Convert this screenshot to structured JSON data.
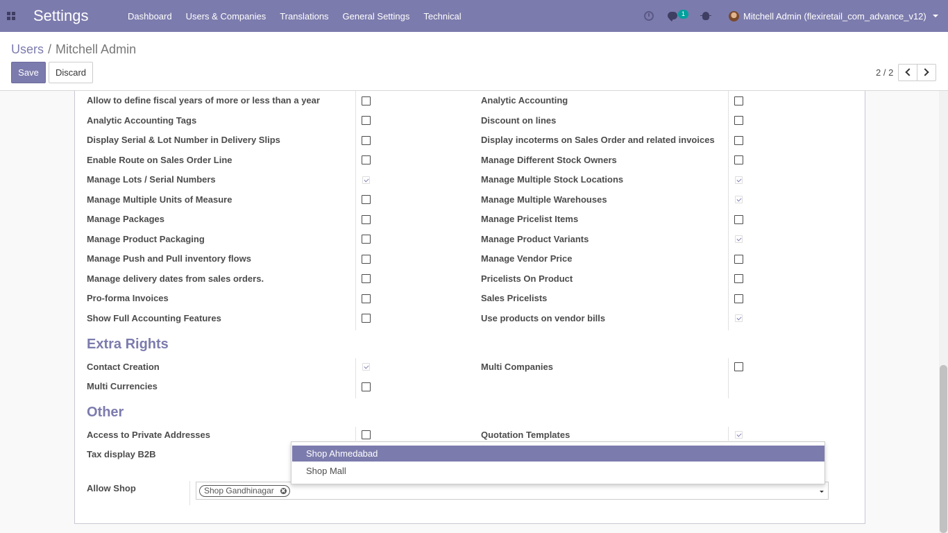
{
  "navbar": {
    "brand": "Settings",
    "menu": [
      "Dashboard",
      "Users & Companies",
      "Translations",
      "General Settings",
      "Technical"
    ],
    "chat_count": "1",
    "user": "Mitchell Admin (flexiretail_com_advance_v12)"
  },
  "control": {
    "breadcrumb_parent": "Users",
    "breadcrumb_sep": "/",
    "breadcrumb_current": "Mitchell Admin",
    "save_label": "Save",
    "discard_label": "Discard",
    "pager": "2 / 2"
  },
  "technical_settings": {
    "left": [
      {
        "label": "Allow to define fiscal years of more or less than a year",
        "checked": false
      },
      {
        "label": "Analytic Accounting Tags",
        "checked": false
      },
      {
        "label": "Display Serial & Lot Number in Delivery Slips",
        "checked": false
      },
      {
        "label": "Enable Route on Sales Order Line",
        "checked": false
      },
      {
        "label": "Manage Lots / Serial Numbers",
        "checked": true
      },
      {
        "label": "Manage Multiple Units of Measure",
        "checked": false
      },
      {
        "label": "Manage Packages",
        "checked": false
      },
      {
        "label": "Manage Product Packaging",
        "checked": false
      },
      {
        "label": "Manage Push and Pull inventory flows",
        "checked": false
      },
      {
        "label": "Manage delivery dates from sales orders.",
        "checked": false
      },
      {
        "label": "Pro-forma Invoices",
        "checked": false
      },
      {
        "label": "Show Full Accounting Features",
        "checked": false
      }
    ],
    "right": [
      {
        "label": "Analytic Accounting",
        "checked": false
      },
      {
        "label": "Discount on lines",
        "checked": false
      },
      {
        "label": "Display incoterms on Sales Order and related invoices",
        "checked": false
      },
      {
        "label": "Manage Different Stock Owners",
        "checked": false
      },
      {
        "label": "Manage Multiple Stock Locations",
        "checked": true
      },
      {
        "label": "Manage Multiple Warehouses",
        "checked": true
      },
      {
        "label": "Manage Pricelist Items",
        "checked": false
      },
      {
        "label": "Manage Product Variants",
        "checked": true
      },
      {
        "label": "Manage Vendor Price",
        "checked": false
      },
      {
        "label": "Pricelists On Product",
        "checked": false
      },
      {
        "label": "Sales Pricelists",
        "checked": false
      },
      {
        "label": "Use products on vendor bills",
        "checked": true
      }
    ]
  },
  "extra_rights": {
    "title": "Extra Rights",
    "left": [
      {
        "label": "Contact Creation",
        "checked": true
      },
      {
        "label": "Multi Currencies",
        "checked": false
      }
    ],
    "right": [
      {
        "label": "Multi Companies",
        "checked": false
      }
    ]
  },
  "other": {
    "title": "Other",
    "left": [
      {
        "label": "Access to Private Addresses",
        "checked": false
      },
      {
        "label": "Tax display B2B",
        "checked": false
      }
    ],
    "right": [
      {
        "label": "Quotation Templates",
        "checked": true
      }
    ]
  },
  "allow_shop": {
    "label": "Allow Shop",
    "tags": [
      "Shop Gandhinagar"
    ],
    "dropdown_options": [
      "Shop Ahmedabad",
      "Shop Mall"
    ],
    "highlighted_option": "Shop Ahmedabad"
  },
  "colors": {
    "brand": "#7c7bad",
    "text": "#4c4c4c",
    "badge": "#00a09d"
  }
}
